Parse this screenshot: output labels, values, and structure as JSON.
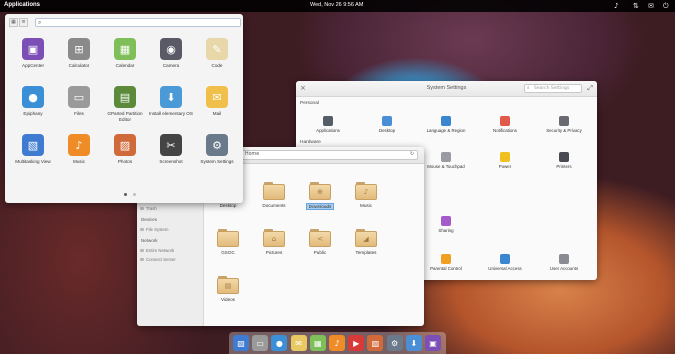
{
  "panel": {
    "applications_label": "Applications",
    "clock": "Wed, Nov 26     9:56 AM",
    "indicators": [
      "sound-icon",
      "network-icon",
      "mail-icon",
      "power-icon"
    ]
  },
  "launcher": {
    "view_buttons": [
      "grid-view-icon",
      "category-view-icon"
    ],
    "search_value": "",
    "apps": [
      {
        "label": "AppCenter",
        "icon": "appcenter-icon",
        "color": "#7b4fb5"
      },
      {
        "label": "Calculator",
        "icon": "calculator-icon",
        "color": "#8a8a8a"
      },
      {
        "label": "Calendar",
        "icon": "calendar-icon",
        "color": "#7fbf5a"
      },
      {
        "label": "Camera",
        "icon": "camera-icon",
        "color": "#5a5a66"
      },
      {
        "label": "Code",
        "icon": "code-icon",
        "color": "#e8d7a8"
      },
      {
        "label": "Epiphany",
        "icon": "epiphany-icon",
        "color": "#3a8fd6"
      },
      {
        "label": "Files",
        "icon": "files-icon",
        "color": "#9a9a9a"
      },
      {
        "label": "GParted Partition Editor",
        "icon": "gparted-icon",
        "color": "#5a8a3a"
      },
      {
        "label": "Install elementary OS",
        "icon": "installer-icon",
        "color": "#4a9ad8"
      },
      {
        "label": "Mail",
        "icon": "mail-icon",
        "color": "#f0c04a"
      },
      {
        "label": "Multitasking View",
        "icon": "multitasking-icon",
        "color": "#3f7bd0"
      },
      {
        "label": "Music",
        "icon": "music-icon",
        "color": "#f08c28"
      },
      {
        "label": "Photos",
        "icon": "photos-icon",
        "color": "#d06a3a"
      },
      {
        "label": "Screenshot",
        "icon": "screenshot-icon",
        "color": "#444444"
      },
      {
        "label": "System Settings",
        "icon": "settings-icon",
        "color": "#6a7a8a"
      }
    ],
    "pages": [
      true,
      false
    ]
  },
  "settings": {
    "title": "System Settings",
    "search_placeholder": "Search Settings",
    "sections": {
      "personal": "Personal",
      "hardware": "Hardware"
    },
    "personal_items": [
      {
        "label": "Applications",
        "color": "#555d66"
      },
      {
        "label": "Desktop",
        "color": "#4a8fd6"
      },
      {
        "label": "Language & Region",
        "color": "#3a86d0"
      },
      {
        "label": "Notifications",
        "color": "#e25a4a"
      },
      {
        "label": "Security & Privacy",
        "color": "#6a6a72"
      }
    ],
    "hardware_items": [
      {
        "label": "Mouse & Touchpad",
        "color": "#9a9aa2"
      },
      {
        "label": "Power",
        "color": "#f0c020"
      },
      {
        "label": "Printers",
        "color": "#4a4a52"
      }
    ],
    "network_items": [
      {
        "label": "Sharing",
        "color": "#a45ac8"
      }
    ],
    "admin_items": [
      {
        "label": "Parental Control",
        "color": "#f0a020"
      },
      {
        "label": "Universal Access",
        "color": "#3a86d0"
      },
      {
        "label": "User Accounts",
        "color": "#8a8a92"
      }
    ]
  },
  "files": {
    "path": "Home",
    "sidebar": {
      "places": [
        "Home",
        "Recent",
        "Videos",
        "Downloads",
        "Trash"
      ],
      "devices_title": "Devices",
      "devices": [
        "File System"
      ],
      "network_title": "Network",
      "network": [
        "Entire Network",
        "Connect Server"
      ]
    },
    "folders": [
      {
        "label": "Desktop",
        "glyph": ""
      },
      {
        "label": "Documents",
        "glyph": ""
      },
      {
        "label": "Downloads",
        "glyph": "⊕",
        "selected": true
      },
      {
        "label": "Music",
        "glyph": "♪"
      },
      {
        "label": "GSOC",
        "glyph": ""
      },
      {
        "label": "Pictures",
        "glyph": "⌂"
      },
      {
        "label": "Public",
        "glyph": "<"
      },
      {
        "label": "Templates",
        "glyph": "◢"
      },
      {
        "label": "Videos",
        "glyph": "▤"
      }
    ]
  },
  "dock": [
    {
      "icon": "multitasking-icon",
      "color": "#3f7bd0"
    },
    {
      "icon": "files-icon",
      "color": "#9a9a9a"
    },
    {
      "icon": "epiphany-icon",
      "color": "#3a8fd6"
    },
    {
      "icon": "mail-icon",
      "color": "#e8c860"
    },
    {
      "icon": "calendar-icon",
      "color": "#7fbf5a"
    },
    {
      "icon": "music-icon",
      "color": "#f08c28"
    },
    {
      "icon": "videos-icon",
      "color": "#d83a3a"
    },
    {
      "icon": "photos-icon",
      "color": "#d06a3a"
    },
    {
      "icon": "settings-icon",
      "color": "#6a7a8a"
    },
    {
      "icon": "appcenter-icon",
      "color": "#4a8fd6"
    },
    {
      "icon": "appcenter-bag-icon",
      "color": "#7b4fb5"
    }
  ]
}
